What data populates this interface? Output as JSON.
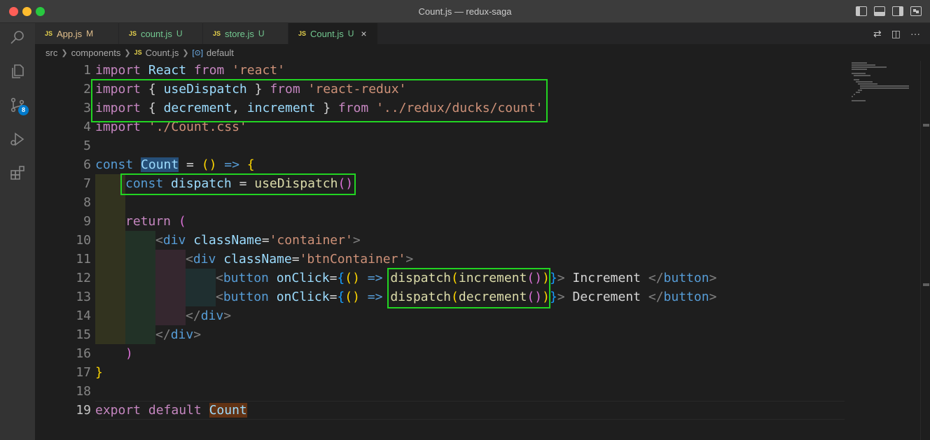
{
  "window": {
    "title": "Count.js — redux-saga"
  },
  "activity_bar": {
    "items": [
      {
        "name": "search-icon"
      },
      {
        "name": "files-icon"
      },
      {
        "name": "source-control-icon",
        "badge": "8"
      },
      {
        "name": "run-debug-icon"
      },
      {
        "name": "extensions-icon"
      }
    ]
  },
  "tabs": [
    {
      "badge": "JS",
      "label": "App.js",
      "status": "M",
      "active": false
    },
    {
      "badge": "JS",
      "label": "count.js",
      "status": "U",
      "active": false
    },
    {
      "badge": "JS",
      "label": "store.js",
      "status": "U",
      "active": false
    },
    {
      "badge": "JS",
      "label": "Count.js",
      "status": "U",
      "active": true,
      "close": "×"
    }
  ],
  "breadcrumbs": {
    "items": [
      "src",
      "components",
      "Count.js",
      "default"
    ],
    "js_badge": "JS"
  },
  "editor": {
    "current_line": 19,
    "line_numbers": [
      "1",
      "2",
      "3",
      "4",
      "5",
      "6",
      "7",
      "8",
      "9",
      "10",
      "11",
      "12",
      "13",
      "14",
      "15",
      "16",
      "17",
      "18",
      "19"
    ],
    "code": {
      "l1": [
        "import",
        " ",
        "React",
        " ",
        "from",
        " ",
        "'react'"
      ],
      "l2": [
        "import",
        " ",
        "{",
        " ",
        "useDispatch",
        " ",
        "}",
        " ",
        "from",
        " ",
        "'react-redux'"
      ],
      "l3": [
        "import",
        " ",
        "{",
        " ",
        "decrement",
        ", ",
        "increment",
        " ",
        "}",
        " ",
        "from",
        " ",
        "'../redux/ducks/count'"
      ],
      "l4": [
        "import",
        " ",
        "'./Count.css'"
      ],
      "l6": [
        "const",
        " ",
        "Count",
        " = ",
        "()",
        " ",
        "=>",
        " ",
        "{"
      ],
      "l7": [
        "const",
        " ",
        "dispatch",
        " = ",
        "useDispatch",
        "()"
      ],
      "l9": [
        "return",
        " ",
        "("
      ],
      "l10": [
        "<",
        "div",
        " ",
        "className",
        "=",
        "'container'",
        ">"
      ],
      "l11": [
        "<",
        "div",
        " ",
        "className",
        "=",
        "'btnContainer'",
        ">"
      ],
      "l12": [
        "<",
        "button",
        " ",
        "onClick",
        "=",
        "{",
        "()",
        " ",
        "=>",
        " ",
        "dispatch",
        "(",
        "increment",
        "()",
        ")",
        "}",
        ">",
        " Increment ",
        "</",
        "button",
        ">"
      ],
      "l13": [
        "<",
        "button",
        " ",
        "onClick",
        "=",
        "{",
        "()",
        " ",
        "=>",
        " ",
        "dispatch",
        "(",
        "decrement",
        "()",
        ")",
        "}",
        ">",
        " Decrement ",
        "</",
        "button",
        ">"
      ],
      "l14": [
        "</",
        "div",
        ">"
      ],
      "l15": [
        "</",
        "div",
        ">"
      ],
      "l16": [
        ")"
      ],
      "l17": [
        "}"
      ],
      "l19": [
        "export",
        " ",
        "default",
        " ",
        "Count"
      ]
    }
  },
  "colors": {
    "highlight_box": "#22d422",
    "accent": "#007acc"
  }
}
